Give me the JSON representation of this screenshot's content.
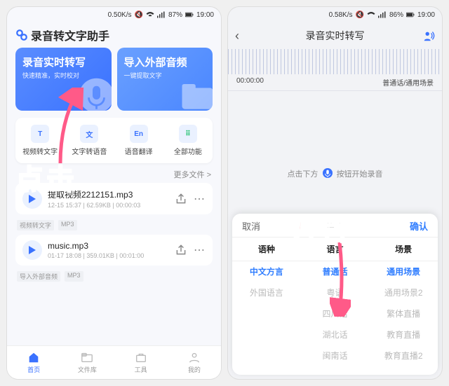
{
  "left": {
    "status": {
      "speed": "0.50K/s",
      "battery": "87%",
      "time": "19:00"
    },
    "app_title": "录音转文字助手",
    "cards": [
      {
        "title": "录音实时转写",
        "subtitle": "快速精准，实时校对"
      },
      {
        "title": "导入外部音频",
        "subtitle": "一键提取文字"
      }
    ],
    "tools": [
      {
        "icon": "T",
        "label": "视频转文字"
      },
      {
        "icon": "文",
        "label": "文字转语音"
      },
      {
        "icon": "En",
        "label": "语音翻译"
      },
      {
        "icon": "⠿",
        "label": "全部功能"
      }
    ],
    "more": "更多文件 >",
    "files": [
      {
        "name": "提取视频2212151.mp3",
        "meta": "12-15 15:37 | 62.59KB | 00:00:03",
        "tags": [
          "视频转文字",
          "MP3"
        ]
      },
      {
        "name": "music.mp3",
        "meta": "01-17 18:08 | 359.01KB | 00:01:00",
        "tags": [
          "导入外部音频",
          "MP3"
        ]
      }
    ],
    "tabs": [
      {
        "label": "首页",
        "active": true
      },
      {
        "label": "文件库",
        "active": false
      },
      {
        "label": "工具",
        "active": false
      },
      {
        "label": "我的",
        "active": false
      }
    ],
    "anno": "点击"
  },
  "right": {
    "status": {
      "speed": "0.58K/s",
      "battery": "86%",
      "time": "19:00"
    },
    "title": "录音实时转写",
    "timer": "00:00:00",
    "mode": "普通话/通用场景",
    "hint_pre": "点击下方",
    "hint_post": "按钮开始录音",
    "sheet": {
      "cancel": "取消",
      "title": "语言",
      "confirm": "确认",
      "heads": [
        "语种",
        "语言",
        "场景"
      ],
      "cols": [
        [
          "中文方言",
          "外国语言"
        ],
        [
          "普通话",
          "粤语",
          "四川话",
          "湖北话",
          "闽南话"
        ],
        [
          "通用场景",
          "通用场景2",
          "繁体直播",
          "教育直播",
          "教育直播2"
        ]
      ],
      "selected": [
        0,
        0,
        0
      ]
    },
    "anno": "方言"
  }
}
